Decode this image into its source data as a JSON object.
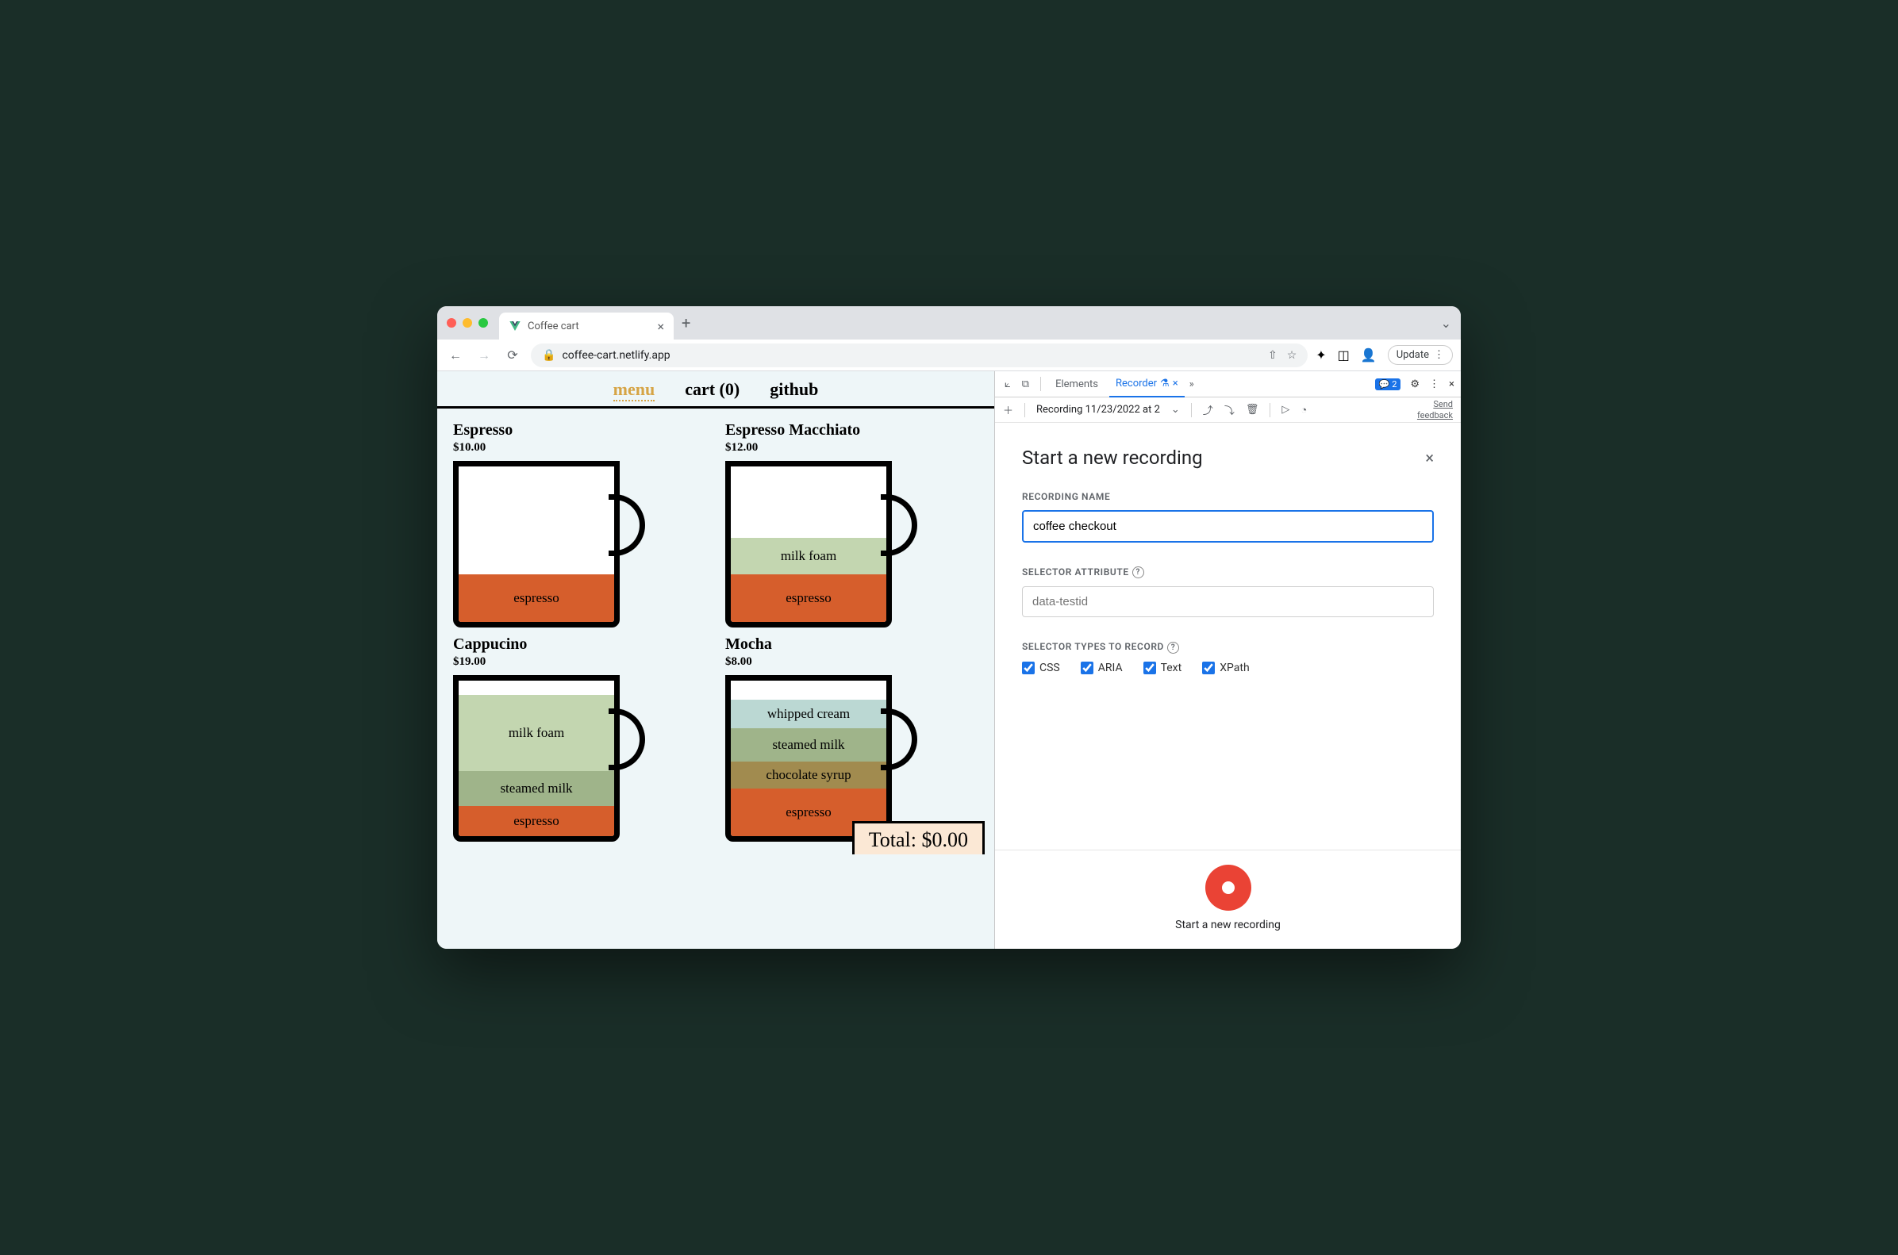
{
  "browser": {
    "tab_title": "Coffee cart",
    "url": "coffee-cart.netlify.app",
    "update_label": "Update"
  },
  "page": {
    "nav": {
      "menu": "menu",
      "cart": "cart (0)",
      "github": "github"
    },
    "products": [
      {
        "name": "Espresso",
        "price": "$10.00",
        "layers": [
          {
            "label": "espresso",
            "cls": "l-espresso"
          }
        ]
      },
      {
        "name": "Espresso Macchiato",
        "price": "$12.00",
        "layers": [
          {
            "label": "milk foam",
            "cls": "l-milkfoam"
          },
          {
            "label": "espresso",
            "cls": "l-espresso"
          }
        ]
      },
      {
        "name": "Cappucino",
        "price": "$19.00",
        "layers": [
          {
            "label": "milk foam",
            "cls": "l-milkfoam"
          },
          {
            "label": "steamed milk",
            "cls": "l-steamed"
          },
          {
            "label": "espresso",
            "cls": "l-espresso"
          }
        ],
        "extra_class": "cappucino"
      },
      {
        "name": "Mocha",
        "price": "$8.00",
        "layers": [
          {
            "label": "whipped cream",
            "cls": "l-whipped"
          },
          {
            "label": "steamed milk",
            "cls": "l-steamed"
          },
          {
            "label": "chocolate syrup",
            "cls": "l-chocsyrup"
          },
          {
            "label": "espresso",
            "cls": "l-espresso"
          }
        ]
      }
    ],
    "total_label": "Total: $0.00"
  },
  "devtools": {
    "tabs": {
      "elements": "Elements",
      "recorder": "Recorder"
    },
    "issues_count": "2",
    "recording_dropdown": "Recording 11/23/2022 at 2",
    "feedback": {
      "l1": "Send",
      "l2": "feedback"
    },
    "panel": {
      "title": "Start a new recording",
      "recording_name_label": "RECORDING NAME",
      "recording_name_value": "coffee checkout",
      "selector_attr_label": "SELECTOR ATTRIBUTE",
      "selector_attr_placeholder": "data-testid",
      "selector_types_label": "SELECTOR TYPES TO RECORD",
      "checks": {
        "css": "CSS",
        "aria": "ARIA",
        "text": "Text",
        "xpath": "XPath"
      },
      "start_label": "Start a new recording"
    }
  }
}
